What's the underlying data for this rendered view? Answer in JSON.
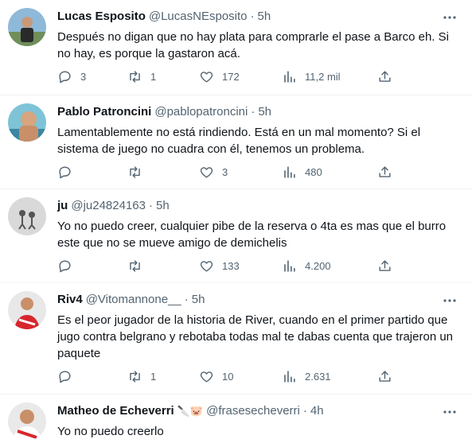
{
  "tweets": [
    {
      "name": "Lucas Esposito",
      "handle": "@LucasNEsposito",
      "dot": "·",
      "time": "5h",
      "text": "Después no digan que no hay plata para comprarle el pase a Barco eh. Si no hay, es porque la gastaron acá.",
      "replies": "3",
      "retweets": "1",
      "likes": "172",
      "views": "11,2 mil"
    },
    {
      "name": "Pablo Patroncini",
      "handle": "@pablopatroncini",
      "dot": "·",
      "time": "5h",
      "text": "Lamentablemente no está rindiendo. Está en un mal momento? Si el sistema de juego no cuadra con él, tenemos un problema.",
      "replies": "",
      "retweets": "",
      "likes": "3",
      "views": "480"
    },
    {
      "name": "ju",
      "handle": "@ju24824163",
      "dot": "·",
      "time": "5h",
      "text": "Yo no puedo creer, cualquier pibe de la reserva o 4ta es mas que el burro este que no se mueve amigo de demichelis",
      "replies": "",
      "retweets": "",
      "likes": "133",
      "views": "4.200"
    },
    {
      "name": "Riv4",
      "handle": "@Vitomannone__",
      "dot": "·",
      "time": "5h",
      "text": "Es el peor jugador de la historia de River, cuando en el primer partido que jugo contra belgrano y rebotaba todas mal te dabas cuenta que trajeron un paquete",
      "replies": "",
      "retweets": "1",
      "likes": "10",
      "views": "2.631"
    },
    {
      "name": "Matheo de Echeverri",
      "name_emoji": "🔪🐷",
      "handle": "@frasesecheverri",
      "dot": "·",
      "time": "4h",
      "text": "Yo no puedo creerlo",
      "replies": "",
      "retweets": "",
      "likes": "",
      "views": ""
    }
  ],
  "icons": {
    "reply": "reply-icon",
    "retweet": "retweet-icon",
    "like": "heart-icon",
    "views": "views-icon",
    "share": "share-icon",
    "more": "more-icon"
  },
  "colors": {
    "text": "#0f1419",
    "secondary": "#536471",
    "divider": "#eff3f4"
  }
}
